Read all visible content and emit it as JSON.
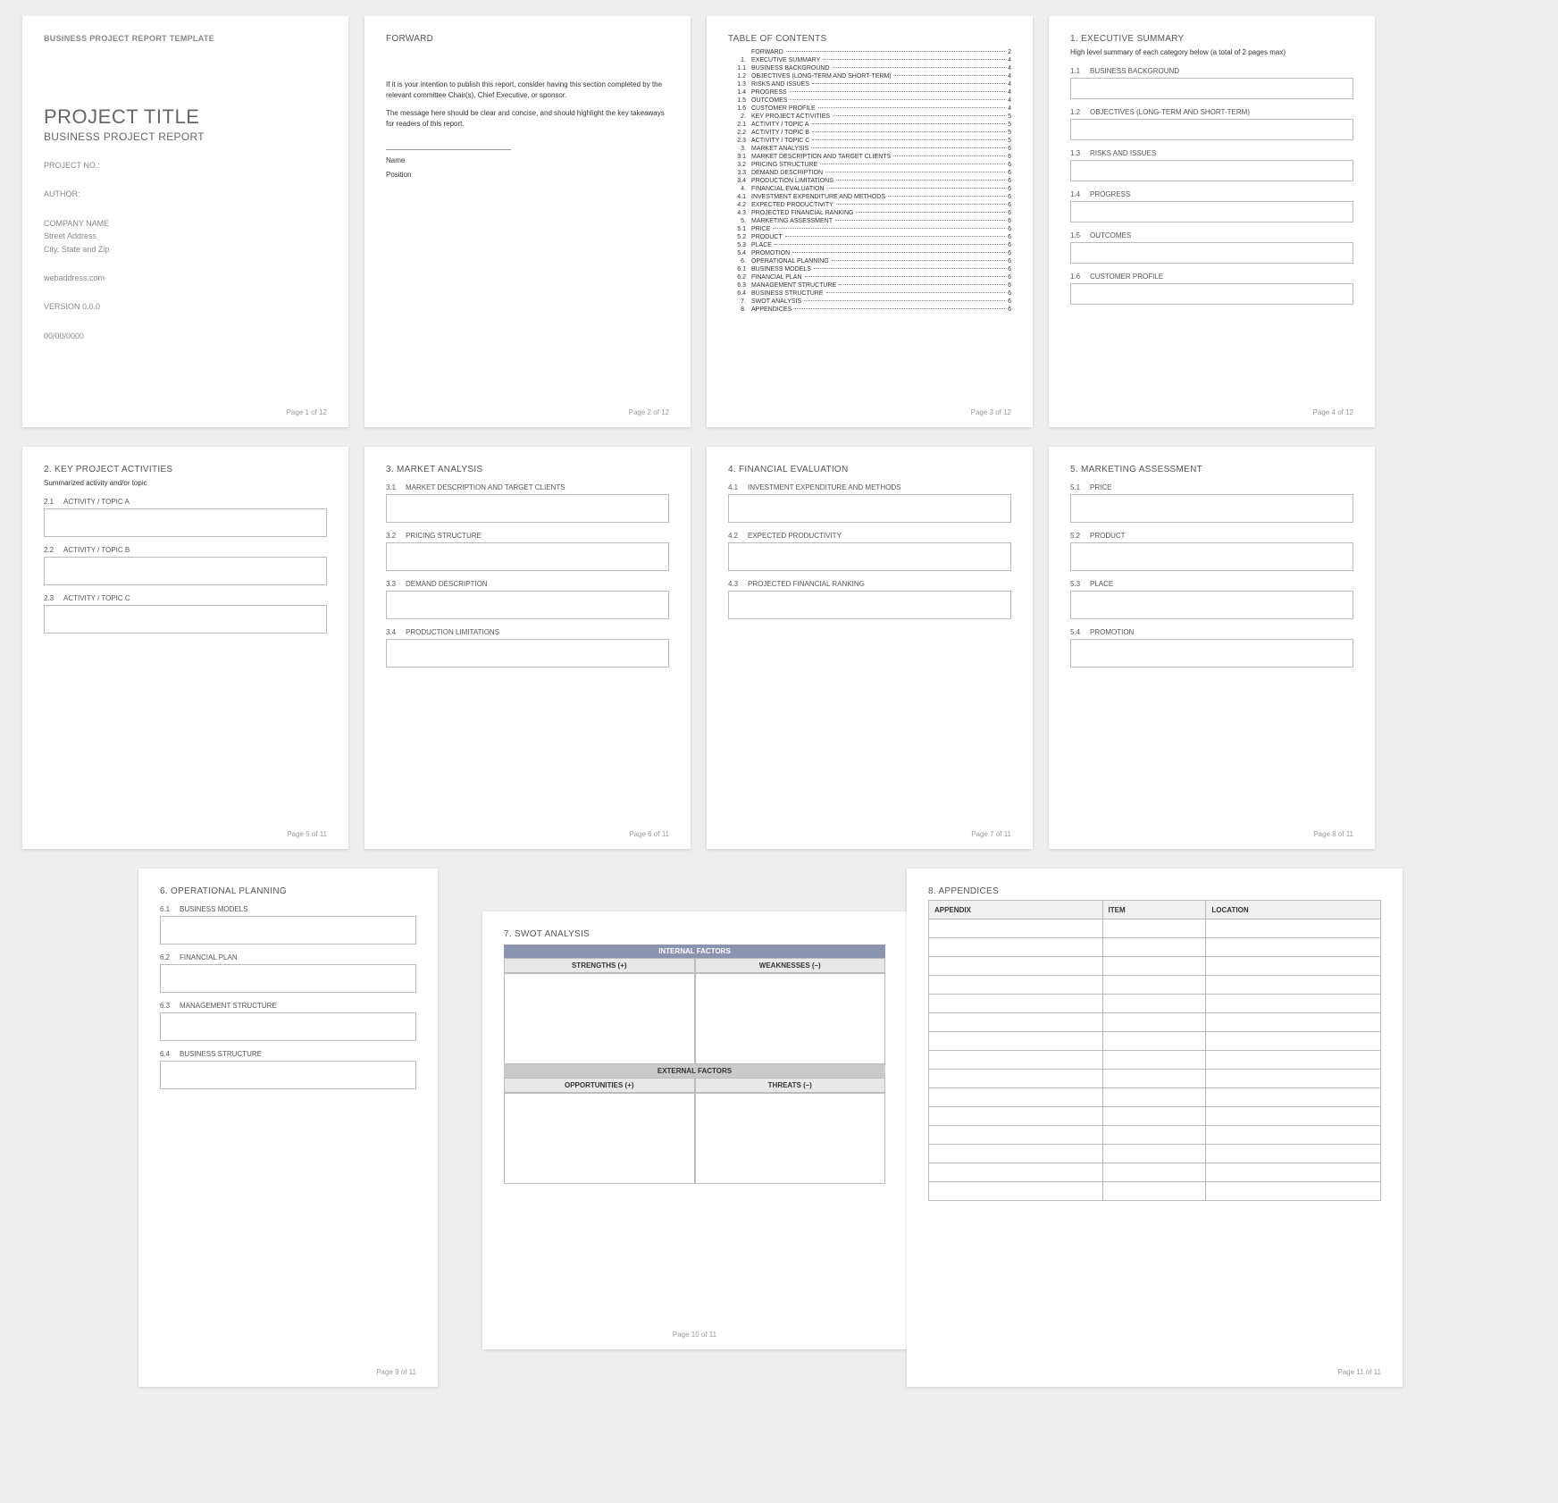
{
  "p1": {
    "header": "BUSINESS PROJECT REPORT TEMPLATE",
    "title": "PROJECT TITLE",
    "subtitle": "BUSINESS PROJECT REPORT",
    "projno": "PROJECT NO.:",
    "author": "AUTHOR:",
    "company": "COMPANY NAME",
    "street": "Street Address",
    "city": "City, State and Zip",
    "web": "webaddress.com",
    "version": "VERSION 0.0.0",
    "date": "00/00/0000",
    "footer": "Page 1 of 12"
  },
  "p2": {
    "header": "FORWARD",
    "para1": "If it is your intention to publish this report, consider having this section completed by the relevant committee Chair(s), Chief Executive, or sponsor.",
    "para2": "The message here should be clear and concise, and should highlight the key takeaways for readers of this report.",
    "name": "Name",
    "position": "Position",
    "footer": "Page 2 of 12"
  },
  "p3": {
    "header": "TABLE OF CONTENTS",
    "footer": "Page 3 of 12",
    "items": [
      {
        "n": "",
        "t": "FORWARD",
        "p": "2"
      },
      {
        "n": "1.",
        "t": "EXECUTIVE SUMMARY",
        "p": "4"
      },
      {
        "n": "1.1",
        "t": "BUSINESS BACKGROUND",
        "p": "4"
      },
      {
        "n": "1.2",
        "t": "OBJECTIVES (LONG-TERM AND SHORT-TERM)",
        "p": "4"
      },
      {
        "n": "1.3",
        "t": "RISKS AND ISSUES",
        "p": "4"
      },
      {
        "n": "1.4",
        "t": "PROGRESS",
        "p": "4"
      },
      {
        "n": "1.5",
        "t": "OUTCOMES",
        "p": "4"
      },
      {
        "n": "1.6",
        "t": "CUSTOMER PROFILE",
        "p": "4"
      },
      {
        "n": "2.",
        "t": "KEY PROJECT ACTIVITIES",
        "p": "5"
      },
      {
        "n": "2.1",
        "t": "ACTIVITY / TOPIC A",
        "p": "5"
      },
      {
        "n": "2.2",
        "t": "ACTIVITY / TOPIC B",
        "p": "5"
      },
      {
        "n": "2.3",
        "t": "ACTIVITY / TOPIC C",
        "p": "5"
      },
      {
        "n": "3.",
        "t": "MARKET ANALYSIS",
        "p": "6"
      },
      {
        "n": "3.1",
        "t": "MARKET DESCRIPTION AND TARGET CLIENTS",
        "p": "6"
      },
      {
        "n": "3.2",
        "t": "PRICING STRUCTURE",
        "p": "6"
      },
      {
        "n": "3.3",
        "t": "DEMAND DESCRIPTION",
        "p": "6"
      },
      {
        "n": "3.4",
        "t": "PRODUCTION LIMITATIONS",
        "p": "6"
      },
      {
        "n": "4.",
        "t": "FINANCIAL EVALUATION",
        "p": "6"
      },
      {
        "n": "4.1",
        "t": "INVESTMENT EXPENDITURE AND METHODS",
        "p": "6"
      },
      {
        "n": "4.2",
        "t": "EXPECTED PRODUCTIVITY",
        "p": "6"
      },
      {
        "n": "4.3",
        "t": "PROJECTED FINANCIAL RANKING",
        "p": "6"
      },
      {
        "n": "5.",
        "t": "MARKETING ASSESSMENT",
        "p": "6"
      },
      {
        "n": "5.1",
        "t": "PRICE",
        "p": "6"
      },
      {
        "n": "5.2",
        "t": "PRODUCT",
        "p": "6"
      },
      {
        "n": "5.3",
        "t": "PLACE",
        "p": "6"
      },
      {
        "n": "5.4",
        "t": "PROMOTION",
        "p": "6"
      },
      {
        "n": "6.",
        "t": "OPERATIONAL PLANNING",
        "p": "6"
      },
      {
        "n": "6.1",
        "t": "BUSINESS MODELS",
        "p": "6"
      },
      {
        "n": "6.2",
        "t": "FINANCIAL PLAN",
        "p": "6"
      },
      {
        "n": "6.3",
        "t": "MANAGEMENT STRUCTURE",
        "p": "6"
      },
      {
        "n": "6.4",
        "t": "BUSINESS STRUCTURE",
        "p": "6"
      },
      {
        "n": "7.",
        "t": "SWOT ANALYSIS",
        "p": "6"
      },
      {
        "n": "8.",
        "t": "APPENDICES",
        "p": "6"
      }
    ]
  },
  "p4": {
    "h": "1.  EXECUTIVE SUMMARY",
    "note": "High level summary of each category below (a total of 2 pages max)",
    "s": [
      {
        "n": "1.1",
        "t": "BUSINESS BACKGROUND"
      },
      {
        "n": "1.2",
        "t": "OBJECTIVES (LONG-TERM AND SHORT-TERM)"
      },
      {
        "n": "1.3",
        "t": "RISKS AND ISSUES"
      },
      {
        "n": "1.4",
        "t": "PROGRESS"
      },
      {
        "n": "1.5",
        "t": "OUTCOMES"
      },
      {
        "n": "1.6",
        "t": "CUSTOMER PROFILE"
      }
    ],
    "footer": "Page 4 of 12"
  },
  "p5": {
    "h": "2.  KEY PROJECT ACTIVITIES",
    "note": "Summarized activity and/or topic",
    "s": [
      {
        "n": "2.1",
        "t": "ACTIVITY / TOPIC A"
      },
      {
        "n": "2.2",
        "t": "ACTIVITY / TOPIC B"
      },
      {
        "n": "2.3",
        "t": "ACTIVITY / TOPIC C"
      }
    ],
    "footer": "Page 5 of 11"
  },
  "p6": {
    "h": "3.  MARKET ANALYSIS",
    "s": [
      {
        "n": "3.1",
        "t": "MARKET DESCRIPTION AND TARGET CLIENTS"
      },
      {
        "n": "3.2",
        "t": "PRICING STRUCTURE"
      },
      {
        "n": "3.3",
        "t": "DEMAND DESCRIPTION"
      },
      {
        "n": "3.4",
        "t": "PRODUCTION LIMITATIONS"
      }
    ],
    "footer": "Page 6 of 11"
  },
  "p7": {
    "h": "4.  FINANCIAL EVALUATION",
    "s": [
      {
        "n": "4.1",
        "t": "INVESTMENT EXPENDITURE AND METHODS"
      },
      {
        "n": "4.2",
        "t": "EXPECTED PRODUCTIVITY"
      },
      {
        "n": "4.3",
        "t": "PROJECTED FINANCIAL RANKING"
      }
    ],
    "footer": "Page 7 of 11"
  },
  "p8": {
    "h": "5.  MARKETING ASSESSMENT",
    "s": [
      {
        "n": "5.1",
        "t": "PRICE"
      },
      {
        "n": "5.2",
        "t": "PRODUCT"
      },
      {
        "n": "5.3",
        "t": "PLACE"
      },
      {
        "n": "5.4",
        "t": "PROMOTION"
      }
    ],
    "footer": "Page 8 of 11"
  },
  "p9": {
    "h": "6.  OPERATIONAL PLANNING",
    "s": [
      {
        "n": "6.1",
        "t": "BUSINESS MODELS"
      },
      {
        "n": "6.2",
        "t": "FINANCIAL PLAN"
      },
      {
        "n": "6.3",
        "t": "MANAGEMENT STRUCTURE"
      },
      {
        "n": "6.4",
        "t": "BUSINESS STRUCTURE"
      }
    ],
    "footer": "Page 9 of 11"
  },
  "p10": {
    "h": "7.  SWOT ANALYSIS",
    "internal": "INTERNAL FACTORS",
    "external": "EXTERNAL FACTORS",
    "strengths": "STRENGTHS (+)",
    "weaknesses": "WEAKNESSES (–)",
    "opportunities": "OPPORTUNITIES (+)",
    "threats": "THREATS (–)",
    "footer": "Page 10 of 11"
  },
  "p11": {
    "h": "8.  APPENDICES",
    "cols": [
      "APPENDIX",
      "ITEM",
      "LOCATION"
    ],
    "rows": 15,
    "footer": "Page 11 of 11"
  }
}
